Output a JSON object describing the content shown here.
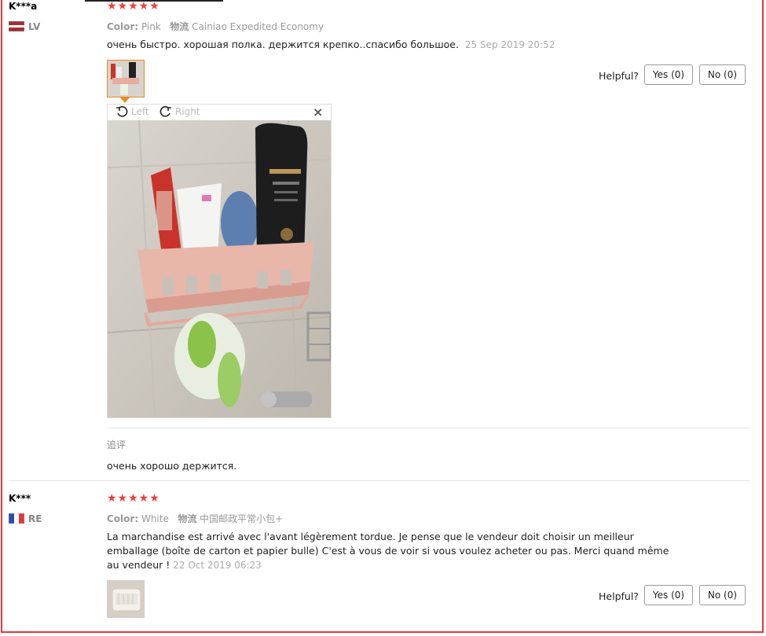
{
  "reviews": [
    {
      "name": "K***a",
      "country": "LV",
      "stars": "★★★★★",
      "color_label": "Color:",
      "color_value": "Pink",
      "logistics_label": "物流",
      "logistics_value": "Cainiao Expedited Economy",
      "text": "очень быстро. хорошая полка. держится крепко..спасибо большое.",
      "date": "25 Sep 2019 20:52",
      "helpful_label": "Helpful?",
      "yes_label": "Yes (0)",
      "no_label": "No (0)",
      "viewer": {
        "rotate_left": "Left",
        "rotate_right": "Right",
        "close": "×"
      },
      "followup_title": "追评",
      "followup_text": "очень хорошо держится."
    },
    {
      "name": "K***",
      "country": "RE",
      "stars": "★★★★★",
      "color_label": "Color:",
      "color_value": "White",
      "logistics_label": "物流",
      "logistics_value": "中国邮政平常小包+",
      "text": "La marchandise est arrivé avec l'avant légèrement tordue. Je pense que le vendeur doit choisir un meilleur emballage (boîte de carton et papier bulle) C'est à vous de voir si vous voulez acheter ou pas. Merci quand même au vendeur !",
      "date": "22 Oct 2019 06:23",
      "helpful_label": "Helpful?",
      "yes_label": "Yes (0)",
      "no_label": "No (0)"
    }
  ],
  "colors": {
    "accent": "#e4393c",
    "star": "#e8403d",
    "thumb_border_active": "#e88c1c",
    "shelf_pink": "#e9b6aa"
  }
}
